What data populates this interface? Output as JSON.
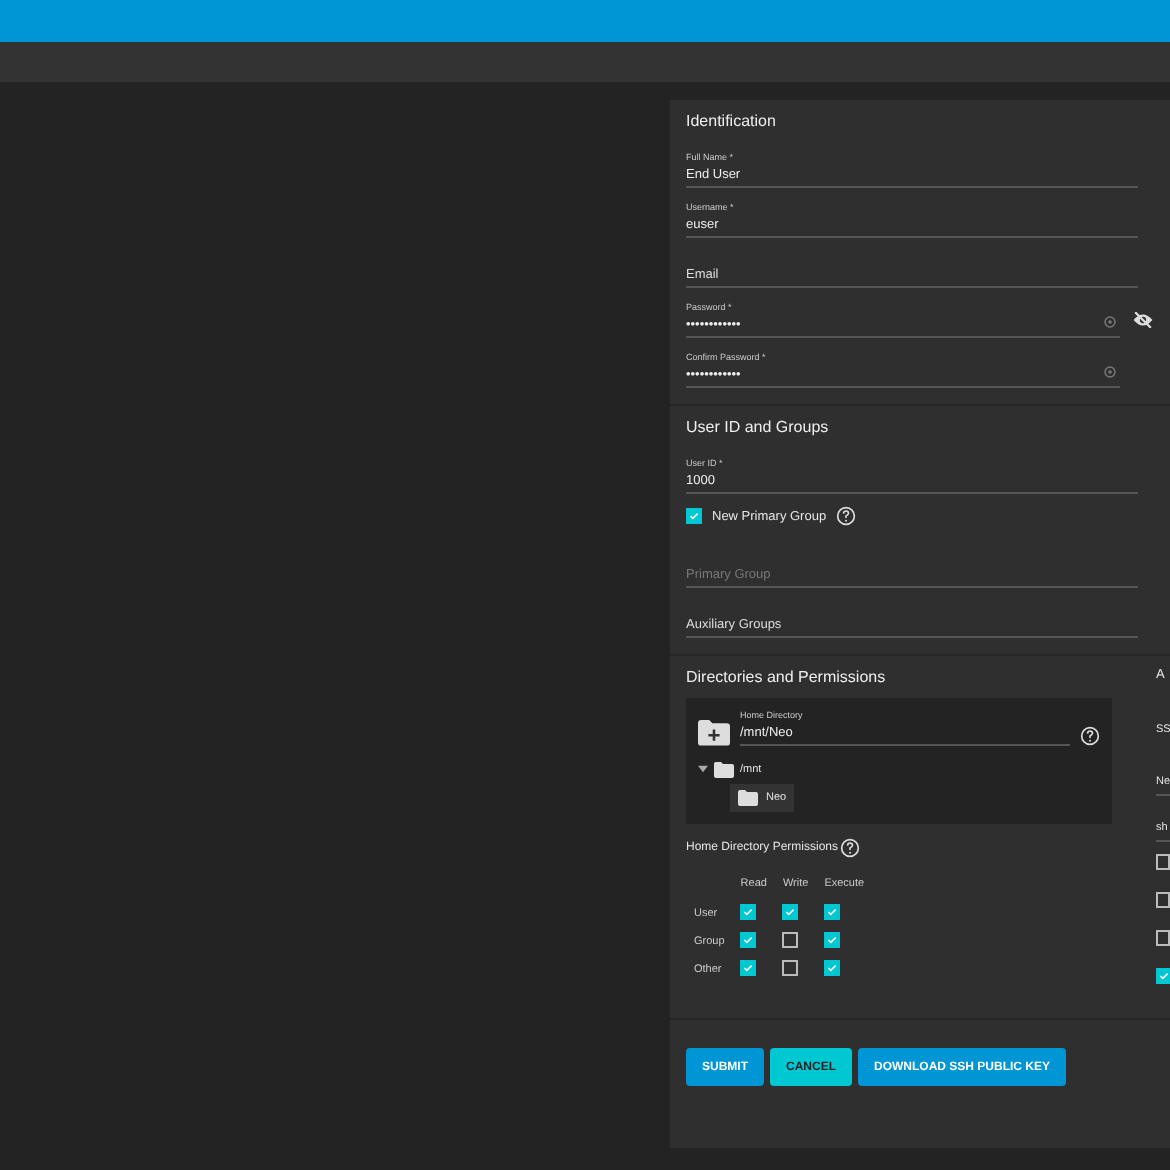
{
  "identification": {
    "title": "Identification",
    "fields": [
      {
        "kind": "text",
        "label": "Full Name *",
        "value": "End User"
      },
      {
        "kind": "text",
        "label": "Username *",
        "value": "euser"
      },
      {
        "kind": "empty",
        "placeholder": "Email"
      },
      {
        "kind": "password",
        "label": "Password *",
        "value": "••••••••••••",
        "toggle": true
      },
      {
        "kind": "password",
        "label": "Confirm Password *",
        "value": "••••••••••••",
        "toggle": false
      }
    ]
  },
  "groups": {
    "title": "User ID and Groups",
    "fields": [
      {
        "kind": "text",
        "label": "User ID *",
        "value": "1000"
      },
      {
        "kind": "checkbox",
        "label": "New Primary Group",
        "checked": true,
        "help": true
      },
      {
        "kind": "empty",
        "placeholder": "Primary Group",
        "disabled": true
      },
      {
        "kind": "empty",
        "placeholder": "Auxiliary Groups",
        "disabled": false
      }
    ]
  },
  "directories": {
    "title": "Directories and Permissions",
    "home": {
      "label": "Home Directory",
      "value": "/mnt/Neo",
      "tree": [
        {
          "name": "/mnt",
          "expanded": true,
          "children": [
            {
              "name": "Neo",
              "selected": true
            }
          ]
        }
      ]
    },
    "permissions": {
      "title": "Home Directory Permissions",
      "columns": [
        "Read",
        "Write",
        "Execute"
      ],
      "rows": [
        {
          "name": "User",
          "values": [
            true,
            true,
            true
          ]
        },
        {
          "name": "Group",
          "values": [
            true,
            false,
            true
          ]
        },
        {
          "name": "Other",
          "values": [
            true,
            false,
            true
          ]
        }
      ]
    }
  },
  "side": {
    "title": "A",
    "items": [
      {
        "kind": "text",
        "text": "SS"
      },
      {
        "kind": "select",
        "text": "Ne"
      },
      {
        "kind": "select",
        "text": "sh"
      },
      {
        "kind": "checkbox",
        "checked": false
      },
      {
        "kind": "checkbox",
        "checked": false
      },
      {
        "kind": "checkbox",
        "checked": false
      },
      {
        "kind": "checkbox",
        "checked": true
      }
    ]
  },
  "buttons": [
    {
      "label": "SUBMIT",
      "kind": "primary"
    },
    {
      "label": "CANCEL",
      "kind": "accent"
    },
    {
      "label": "DOWNLOAD SSH PUBLIC KEY",
      "kind": "primary"
    }
  ]
}
